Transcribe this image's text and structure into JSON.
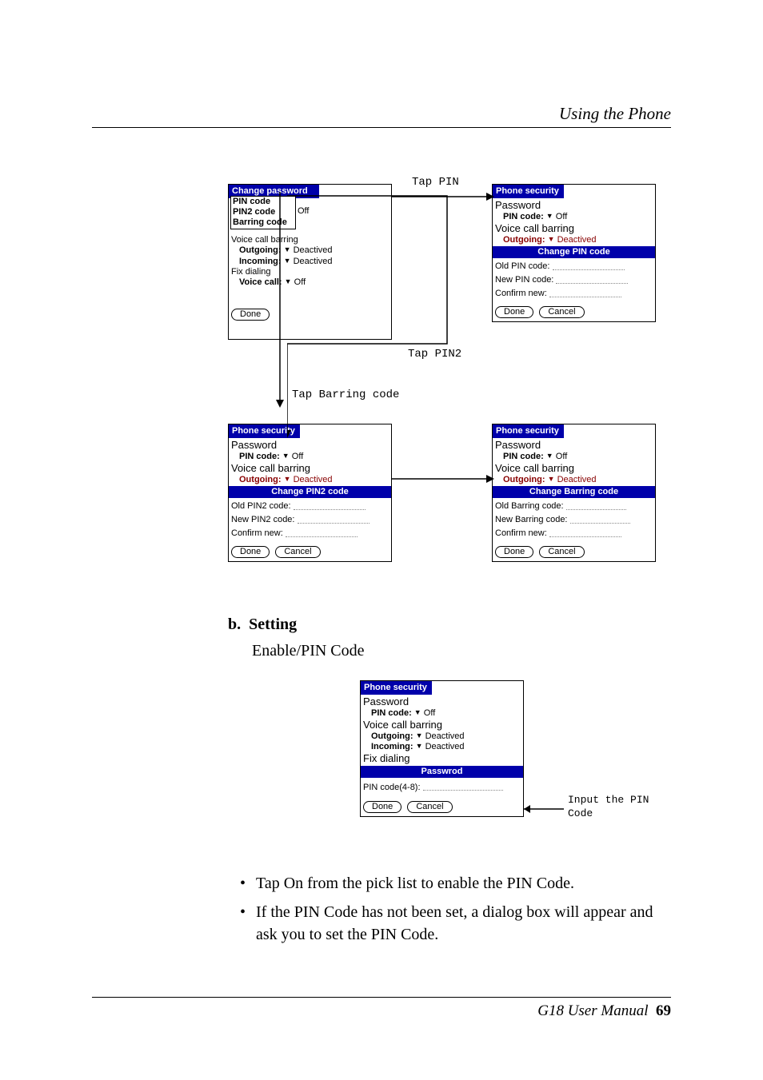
{
  "header": {
    "title": "Using the Phone"
  },
  "labels": {
    "tap_pin": "Tap PIN",
    "tap_pin2": "Tap PIN2",
    "tap_barring": "Tap Barring code",
    "input_pin": "Input the PIN",
    "code": "Code"
  },
  "topLeft": {
    "titlebar": "Change password",
    "menu": {
      "pin": "PIN code",
      "pin2": "PIN2 code",
      "barring": "Barring code",
      "off": "Off"
    },
    "voice_barring": "Voice call barring",
    "outgoing_l": "Outgoing:",
    "outgoing_v": "Deactived",
    "incoming_l": "Incoming:",
    "incoming_v": "Deactived",
    "fix": "Fix dialing",
    "voicecall_l": "Voice call:",
    "voicecall_v": "Off",
    "done": "Done"
  },
  "topRight": {
    "titlebar": "Phone security",
    "password": "Password",
    "pincode_l": "PIN code:",
    "pincode_v": "Off",
    "voice_barring": "Voice call barring",
    "outgoing_l": "Outgoing:",
    "outgoing_v": "Deactived",
    "band": "Change PIN code",
    "old": "Old PIN code:",
    "new": "New PIN code:",
    "confirm": "Confirm new:",
    "done": "Done",
    "cancel": "Cancel"
  },
  "bottomLeft": {
    "titlebar": "Phone security",
    "password": "Password",
    "pincode_l": "PIN code:",
    "pincode_v": "Off",
    "voice_barring": "Voice call barring",
    "outgoing_l": "Outgoing:",
    "outgoing_v": "Deactived",
    "band": "Change PIN2 code",
    "old": "Old PIN2 code:",
    "new": "New PIN2 code:",
    "confirm": "Confirm new:",
    "done": "Done",
    "cancel": "Cancel"
  },
  "bottomRight": {
    "titlebar": "Phone security",
    "password": "Password",
    "pincode_l": "PIN code:",
    "pincode_v": "Off",
    "voice_barring": "Voice call barring",
    "outgoing_l": "Outgoing:",
    "outgoing_v": "Deactived",
    "band": "Change Barring code",
    "old": "Old Barring code:",
    "new": "New Barring code:",
    "confirm": "Confirm new:",
    "done": "Done",
    "cancel": "Cancel"
  },
  "section": {
    "letter": "b.",
    "heading": "Setting",
    "sub": "Enable/PIN Code"
  },
  "center": {
    "titlebar": "Phone security",
    "password": "Password",
    "pincode_l": "PIN code:",
    "pincode_v": "Off",
    "voice_barring": "Voice call barring",
    "outgoing_l": "Outgoing:",
    "outgoing_v": "Deactived",
    "incoming_l": "Incoming:",
    "incoming_v": "Deactived",
    "fix": "Fix dialing",
    "band": "Passwrod",
    "pin48": "PIN code(4-8):",
    "done": "Done",
    "cancel": "Cancel"
  },
  "bullets": {
    "b1": "Tap On from the pick list to enable the PIN Code.",
    "b2": "If the PIN Code has not been set, a dialog box will appear and ask you to set the PIN Code."
  },
  "footer": {
    "title": "G18 User Manual",
    "page": "69"
  }
}
